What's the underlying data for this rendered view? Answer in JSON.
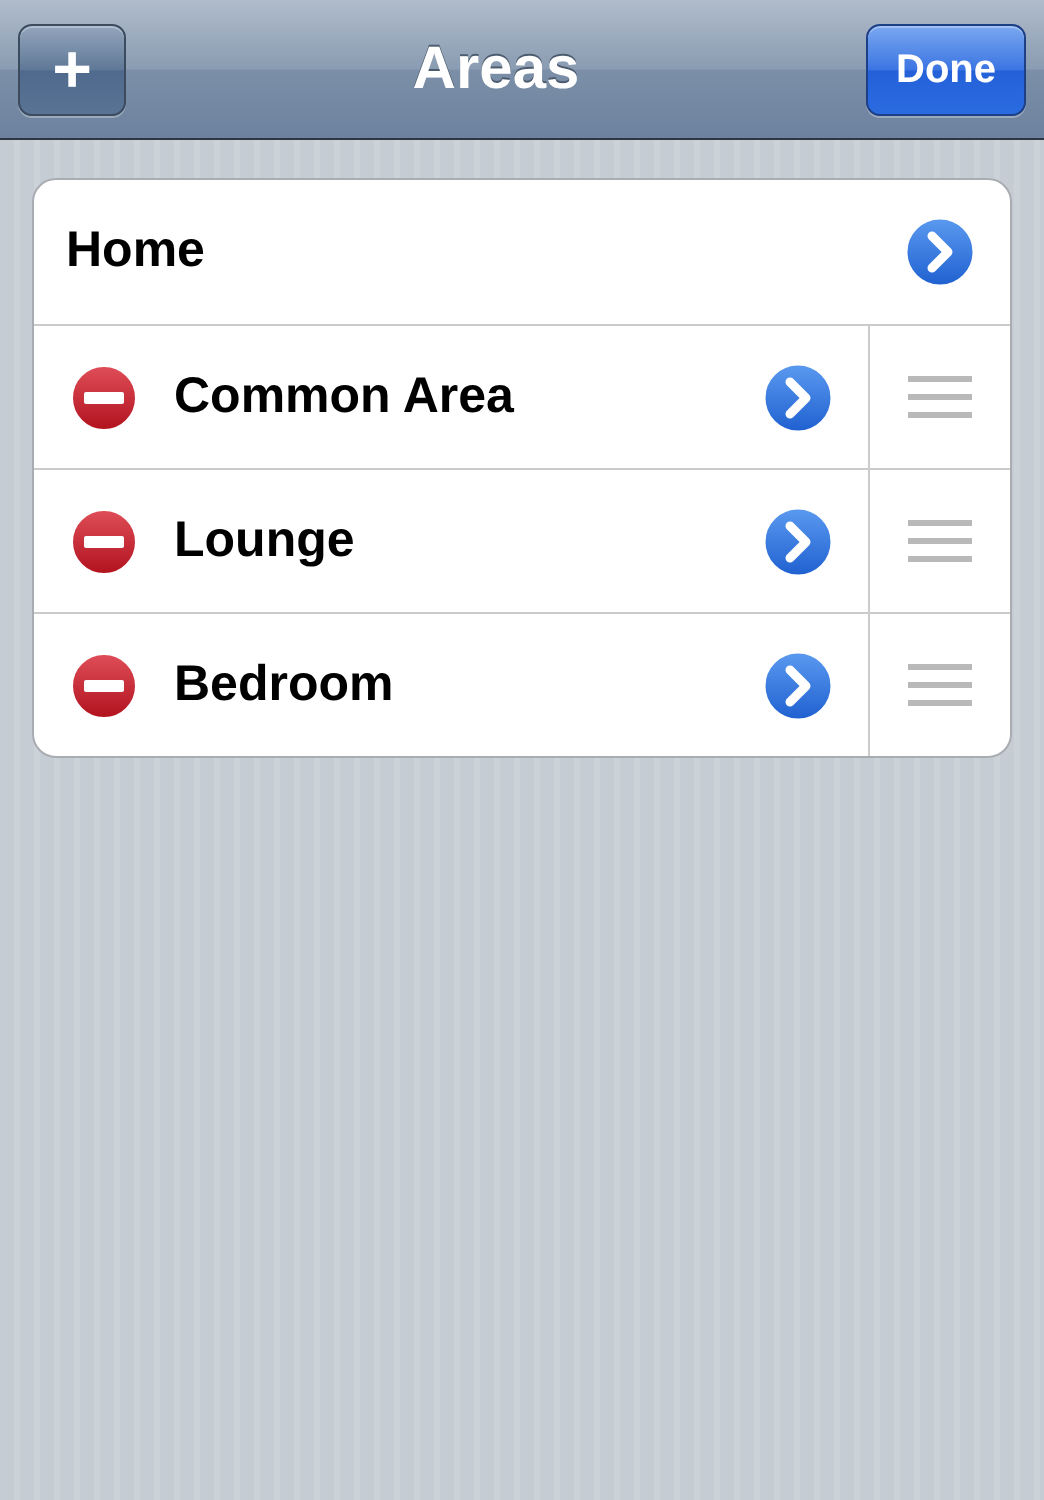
{
  "nav_bar": {
    "add_button": "+",
    "title": "Areas",
    "done_button": "Done"
  },
  "rows": [
    {
      "label": "Home",
      "kind": "plain"
    },
    {
      "label": "Common Area",
      "kind": "editable"
    },
    {
      "label": "Lounge",
      "kind": "editable"
    },
    {
      "label": "Bedroom",
      "kind": "editable"
    }
  ]
}
